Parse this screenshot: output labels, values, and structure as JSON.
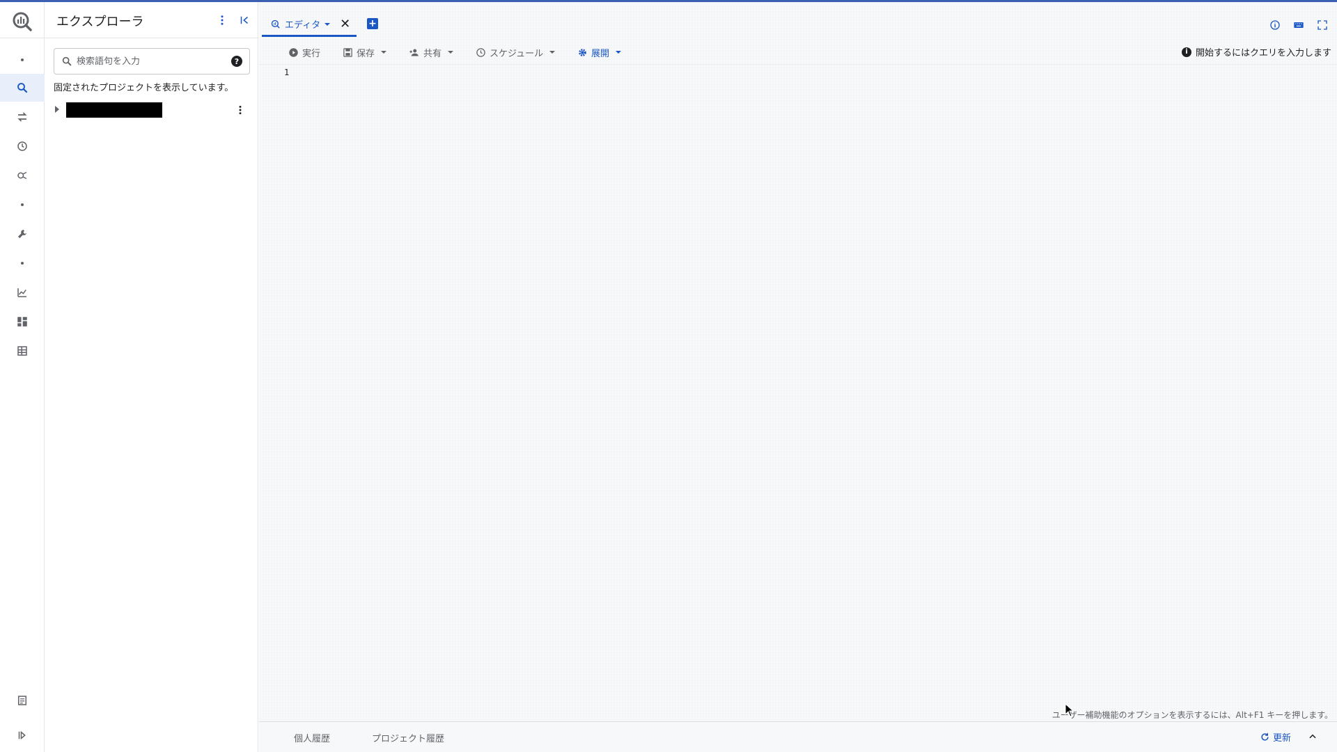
{
  "colors": {
    "accent": "#1a56c4",
    "topbar": "#3b5fb3",
    "muted": "#5f6368"
  },
  "rail": {
    "logo_icon": "bigquery-logo-icon",
    "items": [
      {
        "icon": "dot-icon"
      },
      {
        "icon": "search-icon",
        "active": true
      },
      {
        "icon": "transfer-arrows-icon"
      },
      {
        "icon": "clock-history-icon"
      },
      {
        "icon": "analytics-hub-icon"
      },
      {
        "icon": "dot-icon"
      },
      {
        "icon": "wrench-icon"
      },
      {
        "icon": "dot-icon"
      },
      {
        "icon": "chart-icon"
      },
      {
        "icon": "dashboard-icon"
      },
      {
        "icon": "table-icon"
      }
    ],
    "bottom_items": [
      {
        "icon": "release-notes-icon"
      },
      {
        "icon": "expand-rail-icon"
      }
    ]
  },
  "explorer": {
    "title": "エクスプローラ",
    "search": {
      "placeholder": "検索語句を入力",
      "value": ""
    },
    "help_label": "?",
    "pinned_note": "固定されたプロジェクトを表示しています。",
    "project": {
      "name_redacted": true
    }
  },
  "tabs": [
    {
      "label": "エディタ",
      "icon": "query-icon",
      "active": true
    }
  ],
  "new_tab_label": "+",
  "toolbar": {
    "run": "実行",
    "save": "保存",
    "share": "共有",
    "schedule": "スケジュール",
    "deploy": "展開",
    "hint": "開始するにはクエリを入力します"
  },
  "editor": {
    "line_numbers": [
      "1"
    ],
    "content": ""
  },
  "a11y_note": "ユーザー補助機能のオプションを表示するには、Alt+F1 キーを押します。",
  "bottom": {
    "tabs": [
      "個人履歴",
      "プロジェクト履歴"
    ],
    "refresh": "更新"
  },
  "info_label": "i"
}
